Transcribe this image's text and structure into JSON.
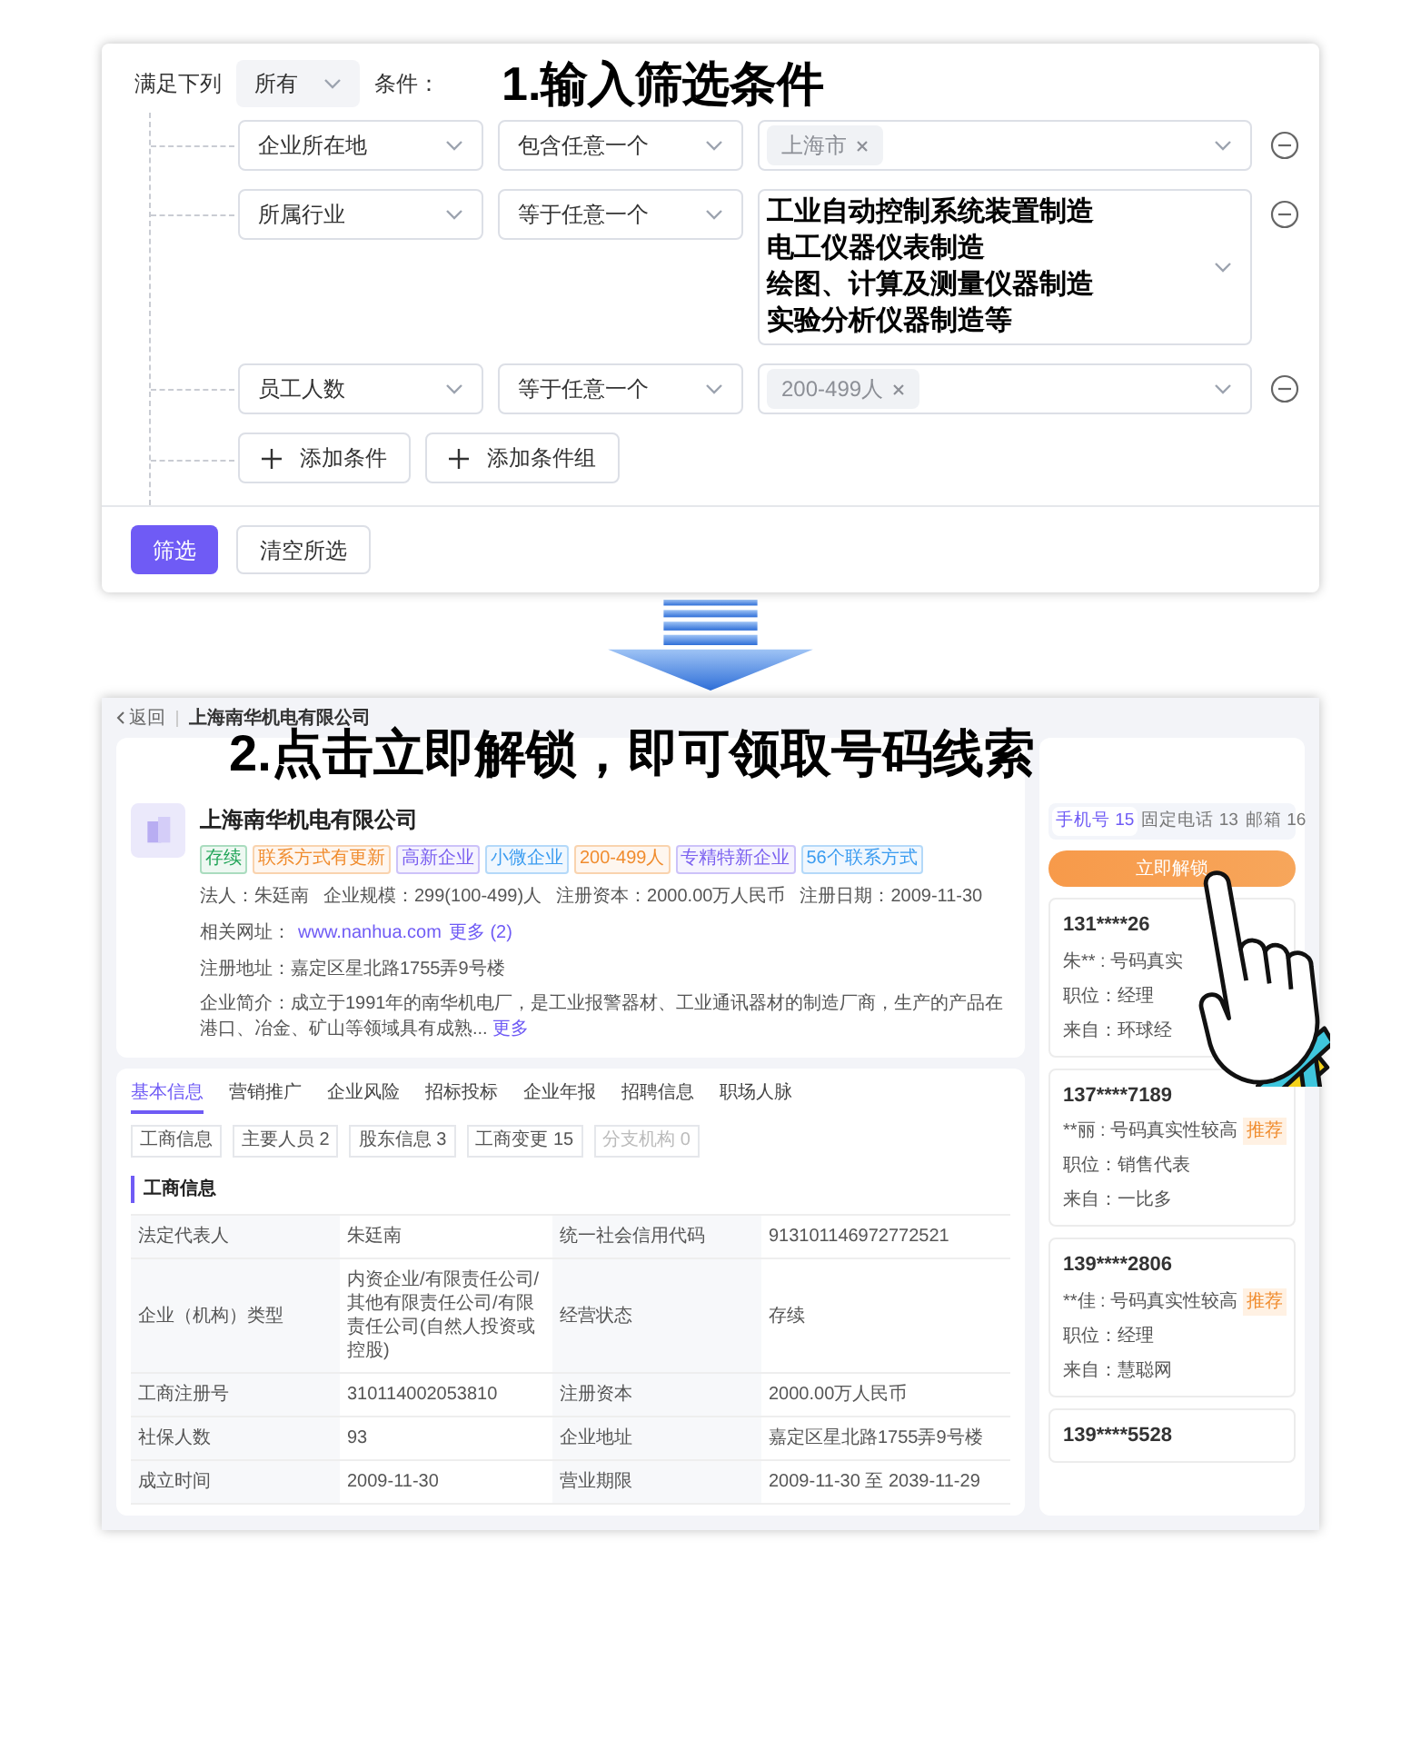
{
  "filter_panel": {
    "match_label": "满足下列",
    "match_mode": "所有",
    "condition_label": "条件：",
    "annotation": "1.输入筛选条件",
    "conditions": [
      {
        "kind": "tags",
        "field": "企业所在地",
        "operator": "包含任意一个",
        "values": [
          "上海市"
        ]
      },
      {
        "kind": "lines",
        "field": "所属行业",
        "operator": "等于任意一个",
        "values": [
          "工业自动控制系统装置制造",
          "电工仪器仪表制造",
          "绘图、计算及测量仪器制造",
          "实验分析仪器制造等"
        ]
      },
      {
        "kind": "tags",
        "field": "员工人数",
        "operator": "等于任意一个",
        "values": [
          "200-499人"
        ]
      }
    ],
    "add_buttons": [
      "添加条件",
      "添加条件组"
    ],
    "buttons": [
      "筛选",
      "清空所选"
    ]
  },
  "detail_panel": {
    "back": "返回",
    "breadcrumb": "上海南华机电有限公司",
    "annotation": "2.点击立即解锁，即可领取号码线索",
    "company": {
      "name": "上海南华机电有限公司",
      "tags": [
        {
          "text": "存续",
          "color": "#22a559"
        },
        {
          "text": "联系方式有更新",
          "color": "#f08c2e"
        },
        {
          "text": "高新企业",
          "color": "#7b61f0"
        },
        {
          "text": "小微企业",
          "color": "#3b9cf0"
        },
        {
          "text": "200-499人",
          "color": "#f08c2e"
        },
        {
          "text": "专精特新企业",
          "color": "#7b61f0"
        },
        {
          "text": "56个联系方式",
          "color": "#3b9cf0"
        }
      ],
      "facts": [
        "法人：朱廷南",
        "企业规模：299(100-499)人",
        "注册资本：2000.00万人民币",
        "注册日期：2009-11-30"
      ],
      "website_label": "相关网址：",
      "website": "www.nanhua.com",
      "website_more": "更多 (2)",
      "address": "注册地址：嘉定区星北路1755弄9号楼",
      "intro": "企业简介：成立于1991年的南华机电厂，是工业报警器材、工业通讯器材的制造厂商，生产的产品在港口、冶金、矿山等领域具有成熟...",
      "intro_more": "更多"
    },
    "tabs": [
      {
        "label": "基本信息",
        "selected": true
      },
      {
        "label": "营销推广",
        "selected": false
      },
      {
        "label": "企业风险",
        "selected": false
      },
      {
        "label": "招标投标",
        "selected": false
      },
      {
        "label": "企业年报",
        "selected": false
      },
      {
        "label": "招聘信息",
        "selected": false
      },
      {
        "label": "职场人脉",
        "selected": false
      }
    ],
    "subtabs": [
      {
        "label": "工商信息",
        "disabled": false
      },
      {
        "label": "主要人员 2",
        "disabled": false
      },
      {
        "label": "股东信息 3",
        "disabled": false
      },
      {
        "label": "工商变更 15",
        "disabled": false
      },
      {
        "label": "分支机构 0",
        "disabled": true
      }
    ],
    "section_title": "工商信息",
    "table": {
      "rows": [
        [
          "法定代表人",
          "朱廷南",
          "统一社会信用代码",
          "913101146972772521"
        ],
        [
          "企业（机构）类型",
          "内资企业/有限责任公司/其他有限责任公司/有限责任公司(自然人投资或控股)",
          "经营状态",
          "存续"
        ],
        [
          "工商注册号",
          "310114002053810",
          "注册资本",
          "2000.00万人民币"
        ],
        [
          "社保人数",
          "93",
          "企业地址",
          "嘉定区星北路1755弄9号楼"
        ],
        [
          "成立时间",
          "2009-11-30",
          "营业期限",
          "2009-11-30 至 2039-11-29"
        ]
      ]
    },
    "contacts": {
      "tabs": [
        {
          "label": "手机号 15",
          "selected": true
        },
        {
          "label": "固定电话 13",
          "selected": false
        },
        {
          "label": "邮箱 16",
          "selected": false
        }
      ],
      "unlock": "立即解锁",
      "items": [
        {
          "phone": "131****26",
          "name": "朱** : 号码真实",
          "position": "职位：经理",
          "source": "来自：环球经"
        },
        {
          "phone": "137****7189",
          "name": "**丽 : 号码真实性较高",
          "tag": "推荐",
          "position": "职位：销售代表",
          "source": "来自：一比多"
        },
        {
          "phone": "139****2806",
          "name": "**佳 : 号码真实性较高",
          "tag": "推荐",
          "position": "职位：经理",
          "source": "来自：慧聪网"
        },
        {
          "phone": "139****5528"
        }
      ]
    }
  }
}
